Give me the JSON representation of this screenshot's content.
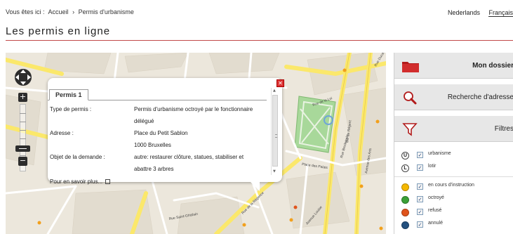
{
  "breadcrumb": {
    "prefix": "Vous êtes ici :",
    "home": "Accueil",
    "sep": "›",
    "current": "Permis d'urbanisme"
  },
  "languages": {
    "nl": "Nederlands",
    "fr": "Français"
  },
  "page_title": "Les permis en ligne",
  "map": {
    "zoom_in": "+",
    "zoom_out": "−",
    "street_labels": {
      "rue_de_la_loi": "Rue de la Loi",
      "place_des_palais": "Place des Palais",
      "rue_brederode": "Rue Brederode",
      "avenue_des_arts": "Avenue des Arts",
      "bd_de_regent": "Bd. de Régent",
      "rue_saint_ghislain": "Rue Saint-Ghislain",
      "rue_de_la_regence": "Rue de la Régence",
      "avenue_louise": "Avenue Louise",
      "rue_ducale": "Rue Ducale"
    }
  },
  "popup": {
    "tab": "Permis 1",
    "close_icon": "close-icon",
    "rows": [
      {
        "label": "Type de permis :",
        "value": "Permis d'urbanisme octroyé par le fonctionnaire délégué"
      },
      {
        "label": "Adresse :",
        "value_line1": "Place du Petit Sablon",
        "value_line2": "1000 Bruxelles"
      },
      {
        "label": "Objet de la demande :",
        "value": "autre: restaurer clôture, statues, stabiliser et abattre 3 arbres"
      }
    ],
    "more_link": "Pour en savoir plus...",
    "external_icon": "external-link-icon"
  },
  "sidebar": {
    "dossier": {
      "label": "Mon dossier",
      "icon": "folder-icon"
    },
    "search": {
      "label": "Recherche d'adresse",
      "icon": "magnifier-icon"
    },
    "filters": {
      "label": "Filtres",
      "icon": "funnel-icon"
    },
    "filter_items": [
      {
        "symbol": "U",
        "label": "urbanisme",
        "checked": true
      },
      {
        "symbol": "L",
        "label": "lotir",
        "checked": true
      }
    ],
    "status_items": [
      {
        "label": "en cours d'instruction",
        "color": "#f5b800",
        "checked": true
      },
      {
        "label": "octroyé",
        "color": "#3aa037",
        "checked": true
      },
      {
        "label": "refusé",
        "color": "#e0541c",
        "checked": true
      },
      {
        "label": "annulé",
        "color": "#23507f",
        "checked": true
      }
    ],
    "check_mark": "✓"
  },
  "colors": {
    "accent_red": "#c24b4b",
    "road_yellow": "#fbe86b",
    "park_green": "#a8d89a",
    "map_bg": "#ece7dc"
  }
}
